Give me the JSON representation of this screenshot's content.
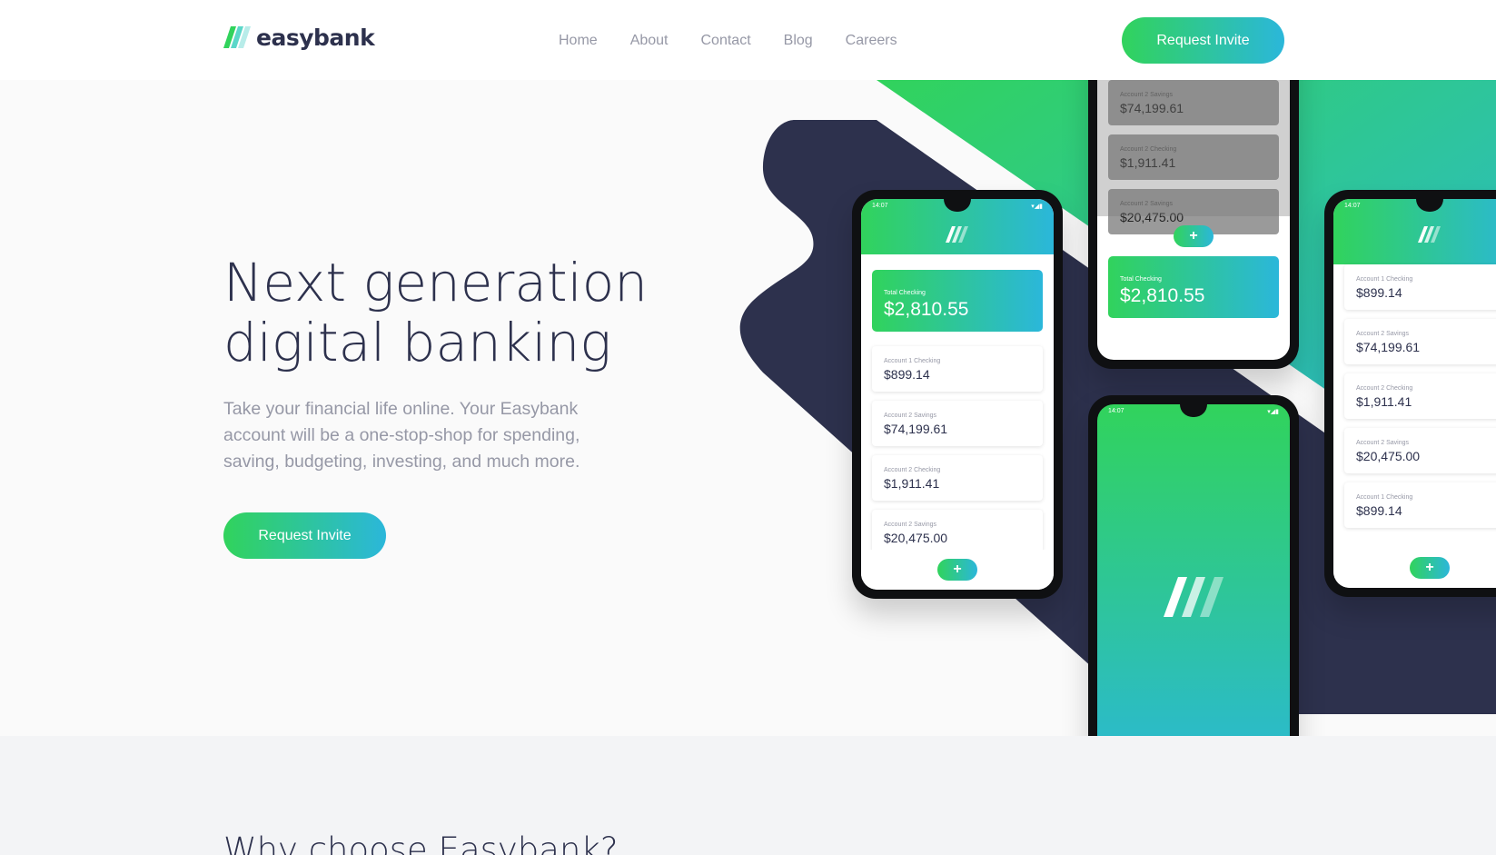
{
  "header": {
    "logo_text": "easybank",
    "nav": [
      "Home",
      "About",
      "Contact",
      "Blog",
      "Careers"
    ],
    "cta": "Request Invite"
  },
  "hero": {
    "title_line1": "Next generation",
    "title_line2": "digital banking",
    "text": "Take your financial life online. Your Easybank account will be a one-stop-shop for spending, saving, budgeting, investing, and much more.",
    "cta": "Request Invite"
  },
  "phones": {
    "time": "14:07",
    "total_label": "Total Checking",
    "total_amount": "$2,810.55",
    "accounts": [
      {
        "label": "Account 1 Checking",
        "amount": "$899.14"
      },
      {
        "label": "Account 2 Savings",
        "amount": "$74,199.61"
      },
      {
        "label": "Account 2 Checking",
        "amount": "$1,911.41"
      },
      {
        "label": "Account 2 Savings",
        "amount": "$20,475.00"
      },
      {
        "label": "Account 1 Checking",
        "amount": "$899.14"
      }
    ],
    "fab_symbol": "+"
  },
  "section2": {
    "title": "Why choose Easybank?"
  },
  "colors": {
    "brand_green": "#31d35c",
    "brand_cyan": "#2bb7da",
    "dark_blue": "#2d314d",
    "grayish_blue": "#9698a6"
  }
}
